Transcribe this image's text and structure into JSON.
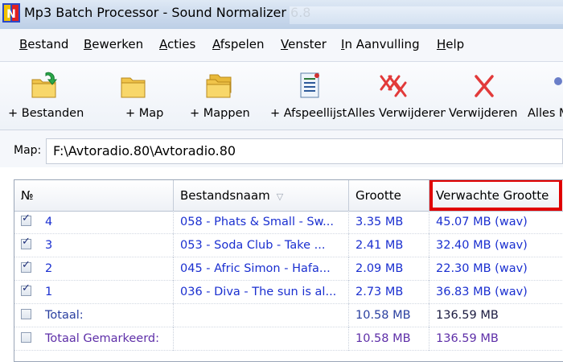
{
  "window": {
    "title": "Mp3 Batch Processor - Sound Normalizer 6.8"
  },
  "menu": [
    {
      "label": "Bestand",
      "underline": "B",
      "rest": "estand"
    },
    {
      "label": "Bewerken",
      "underline": "B",
      "rest": "ewerken"
    },
    {
      "label": "Acties",
      "underline": "A",
      "rest": "cties"
    },
    {
      "label": "Afspelen",
      "underline": "A",
      "rest": "fspelen"
    },
    {
      "label": "Venster",
      "underline": "V",
      "rest": "enster"
    },
    {
      "label": "In Aanvulling",
      "underline": "I",
      "rest": "n Aanvulling"
    },
    {
      "label": "Help",
      "underline": "H",
      "rest": "elp"
    }
  ],
  "toolbar": [
    {
      "label": "+ Bestanden",
      "icon": "folder-add-icon"
    },
    {
      "label": "+ Map",
      "icon": "folder-icon"
    },
    {
      "label": "+ Mappen",
      "icon": "folders-icon"
    },
    {
      "label": "+ Afspeellijst",
      "icon": "playlist-icon"
    },
    {
      "label": "Alles Verwijderen",
      "icon": "remove-all-icon"
    },
    {
      "label": "Verwijderen",
      "icon": "remove-icon"
    },
    {
      "label": "Alles M",
      "icon": "mark-all-icon"
    }
  ],
  "path": {
    "label": "Map:",
    "value": "F:\\Avtoradio.80\\Avtoradio.80"
  },
  "table": {
    "columns": [
      "№",
      "Bestandsnaam",
      "Grootte",
      "Verwachte Grootte"
    ],
    "rows": [
      {
        "checked": true,
        "no": "4",
        "name": "058 - Phats & Small - Sw...",
        "size": "3.35 MB",
        "expected": "45.07 MB (wav)"
      },
      {
        "checked": true,
        "no": "3",
        "name": "053 - Soda Club - Take ...",
        "size": "2.41 MB",
        "expected": "32.40 MB (wav)"
      },
      {
        "checked": true,
        "no": "2",
        "name": "045 - Afric Simon - Hafa...",
        "size": "2.09 MB",
        "expected": "22.30 MB (wav)"
      },
      {
        "checked": true,
        "no": "1",
        "name": "036 - Diva - The sun is al...",
        "size": "2.73 MB",
        "expected": "36.83 MB (wav)"
      }
    ],
    "total": {
      "label": "Totaal:",
      "size": "10.58 MB",
      "expected": "136.59 MB",
      "checked": false
    },
    "total_marked": {
      "label": "Totaal Gemarkeerd:",
      "size": "10.58 MB",
      "expected": "136.59 MB",
      "checked": false
    }
  },
  "colors": {
    "highlight": "#e00000",
    "row_text": "#1a2fd0",
    "marked_text": "#5e2fa8"
  }
}
